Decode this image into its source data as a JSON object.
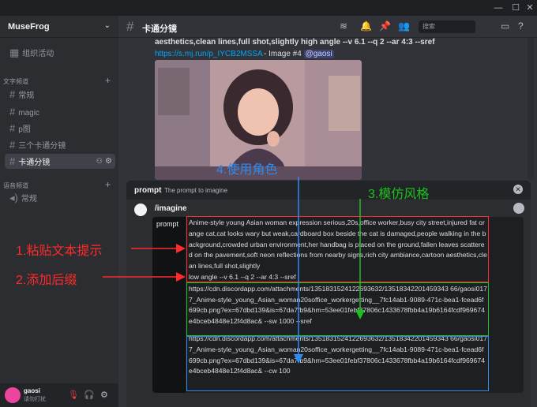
{
  "window": {
    "min": "—",
    "max": "☐",
    "close": "✕"
  },
  "sidebar": {
    "server_name": "MuseFrog",
    "activity": "组织活动",
    "text_category": "文字频道",
    "channels": [
      "常规",
      "magic",
      "p图",
      "三个卡通分镜",
      "卡通分镜"
    ],
    "voice_category": "语音频道",
    "voice_channels": [
      "常规"
    ]
  },
  "user": {
    "name": "gaosi",
    "status": "请勿打扰"
  },
  "header": {
    "channel": "卡通分镜",
    "search_placeholder": "搜索"
  },
  "message": {
    "text": "aesthetics,clean lines,full shot,slightly high angle --v 6.1 --q 2 --ar 4:3 --sref",
    "link": "https://s.mj.run/p_IYCB2MSSA",
    "meta": " - Image #4 ",
    "mention": "@gaosi"
  },
  "panel": {
    "name": "prompt",
    "description": "The prompt to imagine",
    "command": "/imagine",
    "option_label": "prompt",
    "prompt_text": "Anime-style young Asian woman expression serious,20s,office worker,busy city street,injured fat orange cat,cat looks wary but weak,cardboard box beside the cat is damaged,people walking in the background,crowded urban environment,her handbag is placed on the ground,fallen leaves scattered on the pavement,soft neon reflections from nearby signs,rich city ambiance,cartoon aesthetics,clean lines,full shot,slightly",
    "suffix": "low angle --v 6.1 --q 2 --ar 4:3 --sref",
    "url1": "https://cdn.discordapp.com/attachments/1351831524122693632/13518342201459343 66/gaosi0177_Anime-style_young_Asian_woman20soffice_workergetting__7fc14ab1-9089-471c-bea1-fcead6f699cb.png?ex=67dbd139&is=67da7fb9&hm=53ee01febf37806c1433678fbb4a19b6164fcdf969674e4bceb4848e12f4d8ac& --sw 1000 --sref",
    "url2": "https://cdn.discordapp.com/attachments/1351831524122693632/13518342201459343 66/gaosi0177_Anime-style_young_Asian_woman20soffice_workergetting__7fc14ab1-9089-471c-bea1-fcead6f699cb.png?ex=67dbd139&is=67da7fb9&hm=53ee01febf37806c1433678fbb4a19b6164fcdf969674e4bceb4848e12f4d8ac& --cw 100"
  },
  "annotations": {
    "step1": "1.粘贴文本提示",
    "step2": "2.添加后缀",
    "step3": "3.模仿风格",
    "step4": "4.使用角色"
  },
  "colors": {
    "red": "#ff2a2a",
    "green": "#1cc21c",
    "blue": "#2d8cf0"
  }
}
